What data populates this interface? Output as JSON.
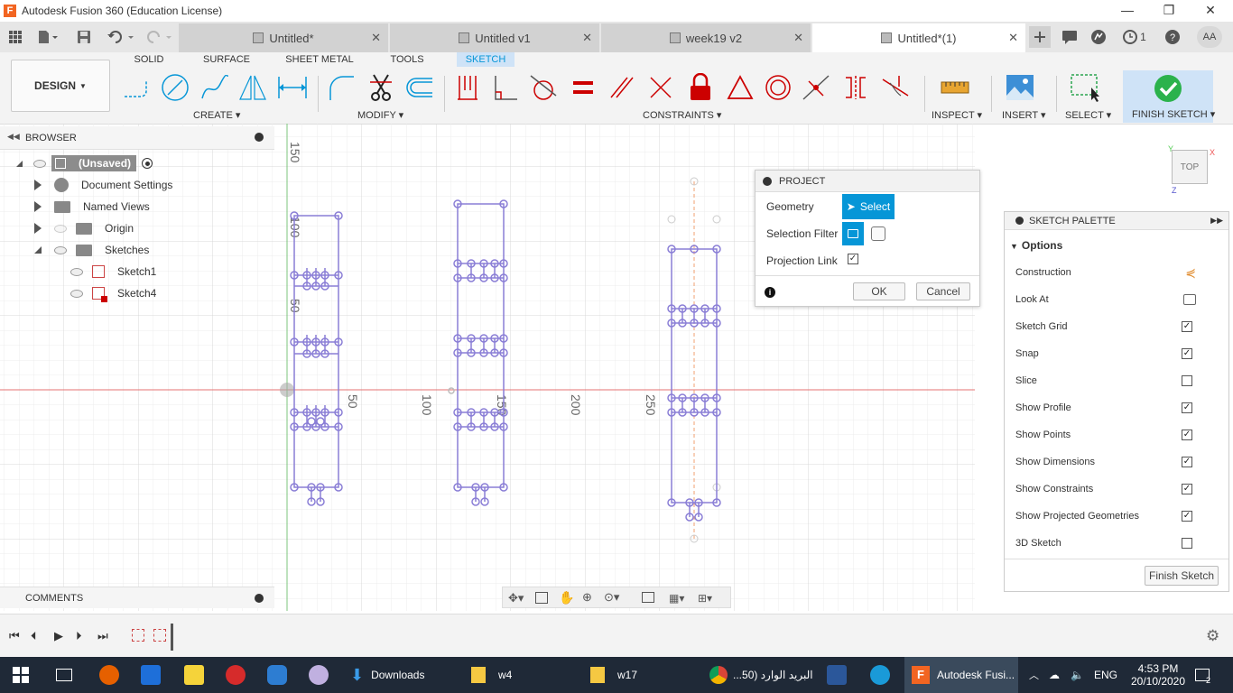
{
  "window": {
    "title": "Autodesk Fusion 360 (Education License)",
    "logo_letter": "F"
  },
  "window_controls": {
    "minimize": "—",
    "maximize": "❐",
    "close": "✕"
  },
  "tabs": [
    {
      "label": "Untitled*",
      "active": false
    },
    {
      "label": "Untitled v1",
      "active": false
    },
    {
      "label": "week19 v2",
      "active": false
    },
    {
      "label": "Untitled*(1)",
      "active": true
    }
  ],
  "header_right": {
    "jobs_count": "1",
    "avatar": "AA"
  },
  "toolbar": {
    "workspace": "DESIGN",
    "tabs": [
      "SOLID",
      "SURFACE",
      "SHEET METAL",
      "TOOLS",
      "SKETCH"
    ],
    "active_tab": "SKETCH",
    "groups": {
      "create": "CREATE",
      "modify": "MODIFY",
      "constraints": "CONSTRAINTS",
      "inspect": "INSPECT",
      "insert": "INSERT",
      "select": "SELECT",
      "finish": "FINISH SKETCH"
    }
  },
  "browser": {
    "title": "BROWSER",
    "root": "(Unsaved)",
    "items": [
      {
        "label": "Document Settings"
      },
      {
        "label": "Named Views"
      },
      {
        "label": "Origin"
      },
      {
        "label": "Sketches"
      },
      {
        "label": "Sketch1"
      },
      {
        "label": "Sketch4"
      }
    ]
  },
  "canvas": {
    "axis_labels_x": [
      "50",
      "100",
      "150",
      "200",
      "250"
    ],
    "axis_labels_y": [
      "150",
      "100",
      "50"
    ]
  },
  "project_dialog": {
    "title": "PROJECT",
    "geometry_label": "Geometry",
    "select_button": "Select",
    "selection_filter_label": "Selection Filter",
    "projection_link_label": "Projection Link",
    "projection_link_checked": true,
    "ok": "OK",
    "cancel": "Cancel",
    "info_icon": "i"
  },
  "sketch_palette": {
    "title": "SKETCH PALETTE",
    "section": "Options",
    "options": [
      {
        "label": "Construction",
        "type": "icon"
      },
      {
        "label": "Look At",
        "type": "icon"
      },
      {
        "label": "Sketch Grid",
        "checked": true
      },
      {
        "label": "Snap",
        "checked": true
      },
      {
        "label": "Slice",
        "checked": false
      },
      {
        "label": "Show Profile",
        "checked": true
      },
      {
        "label": "Show Points",
        "checked": true
      },
      {
        "label": "Show Dimensions",
        "checked": true
      },
      {
        "label": "Show Constraints",
        "checked": true
      },
      {
        "label": "Show Projected Geometries",
        "checked": true
      },
      {
        "label": "3D Sketch",
        "checked": false
      }
    ],
    "finish_button": "Finish Sketch"
  },
  "view_cube": {
    "face": "TOP",
    "x_label": "X",
    "y_label": "Y",
    "z_label": "Z"
  },
  "comments": {
    "title": "COMMENTS"
  },
  "taskbar": {
    "items": [
      {
        "label": "Downloads"
      },
      {
        "label": "w4"
      },
      {
        "label": "w17"
      },
      {
        "label": "البريد الوارد (50..."
      },
      {
        "label": "Autodesk Fusi..."
      }
    ],
    "lang": "ENG",
    "time": "4:53 PM",
    "date": "20/10/2020",
    "notifications": "2"
  }
}
